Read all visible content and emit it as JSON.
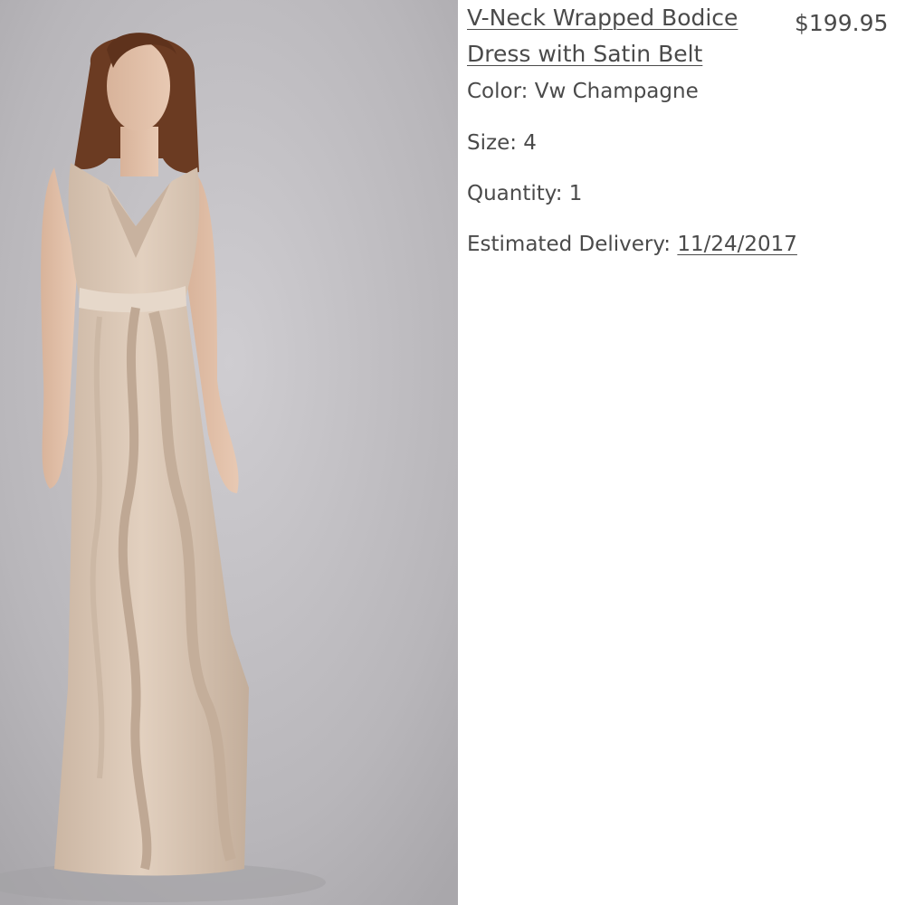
{
  "product": {
    "title": "V-Neck Wrapped Bodice Dress with Satin Belt",
    "price": "$199.95",
    "color_label": "Color:",
    "color_value": "Vw Champagne",
    "size_label": "Size:",
    "size_value": "4",
    "quantity_label": "Quantity:",
    "quantity_value": "1",
    "delivery_label": "Estimated Delivery:",
    "delivery_value": "11/24/2017"
  },
  "colors": {
    "text": "#4a4a4a",
    "backdrop": "#b9b7bb",
    "dress": "#d9c6b4",
    "hair": "#6b3b22"
  }
}
